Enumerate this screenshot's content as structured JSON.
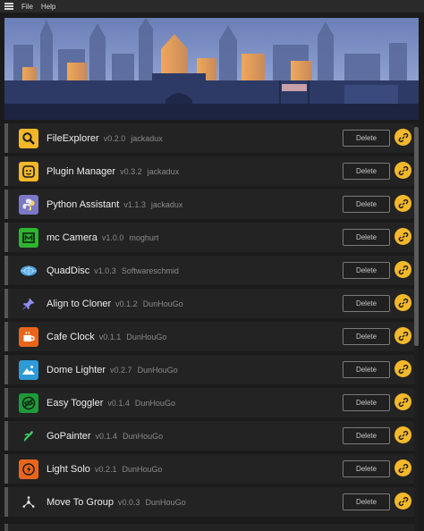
{
  "menu": {
    "file": "File",
    "help": "Help"
  },
  "plugins": [
    {
      "name": "FileExplorer",
      "version": "v0.2.0",
      "author": "jackadux",
      "icon": "magnifier-icon",
      "icon_bg": "#f2b72a"
    },
    {
      "name": "Plugin Manager",
      "version": "v0.3.2",
      "author": "jackadux",
      "icon": "smiley-icon",
      "icon_bg": "#f2b72a"
    },
    {
      "name": "Python Assistant",
      "version": "v1.1.3",
      "author": "jackadux",
      "icon": "python-icon",
      "icon_bg": "#7b78c8"
    },
    {
      "name": "mc Camera",
      "version": "v1.0.0",
      "author": "moghurt",
      "icon": "camera-icon",
      "icon_bg": "#2fb52f"
    },
    {
      "name": "QuadDisc",
      "version": "v1.0.3",
      "author": "Softwareschmid",
      "icon": "disc-icon",
      "icon_bg": "#232323"
    },
    {
      "name": "Align to Cloner",
      "version": "v0.1.2",
      "author": "DunHouGo",
      "icon": "pin-icon",
      "icon_bg": "#232323"
    },
    {
      "name": "Cafe Clock",
      "version": "v0.1.1",
      "author": "DunHouGo",
      "icon": "coffee-icon",
      "icon_bg": "#e8661c"
    },
    {
      "name": "Dome Lighter",
      "version": "v0.2.7",
      "author": "DunHouGo",
      "icon": "mountain-icon",
      "icon_bg": "#2e9ad8"
    },
    {
      "name": "Easy Toggler",
      "version": "v0.1.4",
      "author": "DunHouGo",
      "icon": "eye-slash-icon",
      "icon_bg": "#1f9a3a"
    },
    {
      "name": "GoPainter",
      "version": "v0.1.4",
      "author": "DunHouGo",
      "icon": "painter-icon",
      "icon_bg": "#232323"
    },
    {
      "name": "Light Solo",
      "version": "v0.2.1",
      "author": "DunHouGo",
      "icon": "bulb-icon",
      "icon_bg": "#e8661c"
    },
    {
      "name": "Move To Group",
      "version": "v0.0.3",
      "author": "DunHouGo",
      "icon": "group-icon",
      "icon_bg": "#232323"
    }
  ],
  "delete_label": "Delete",
  "accent": "#f3b82b"
}
